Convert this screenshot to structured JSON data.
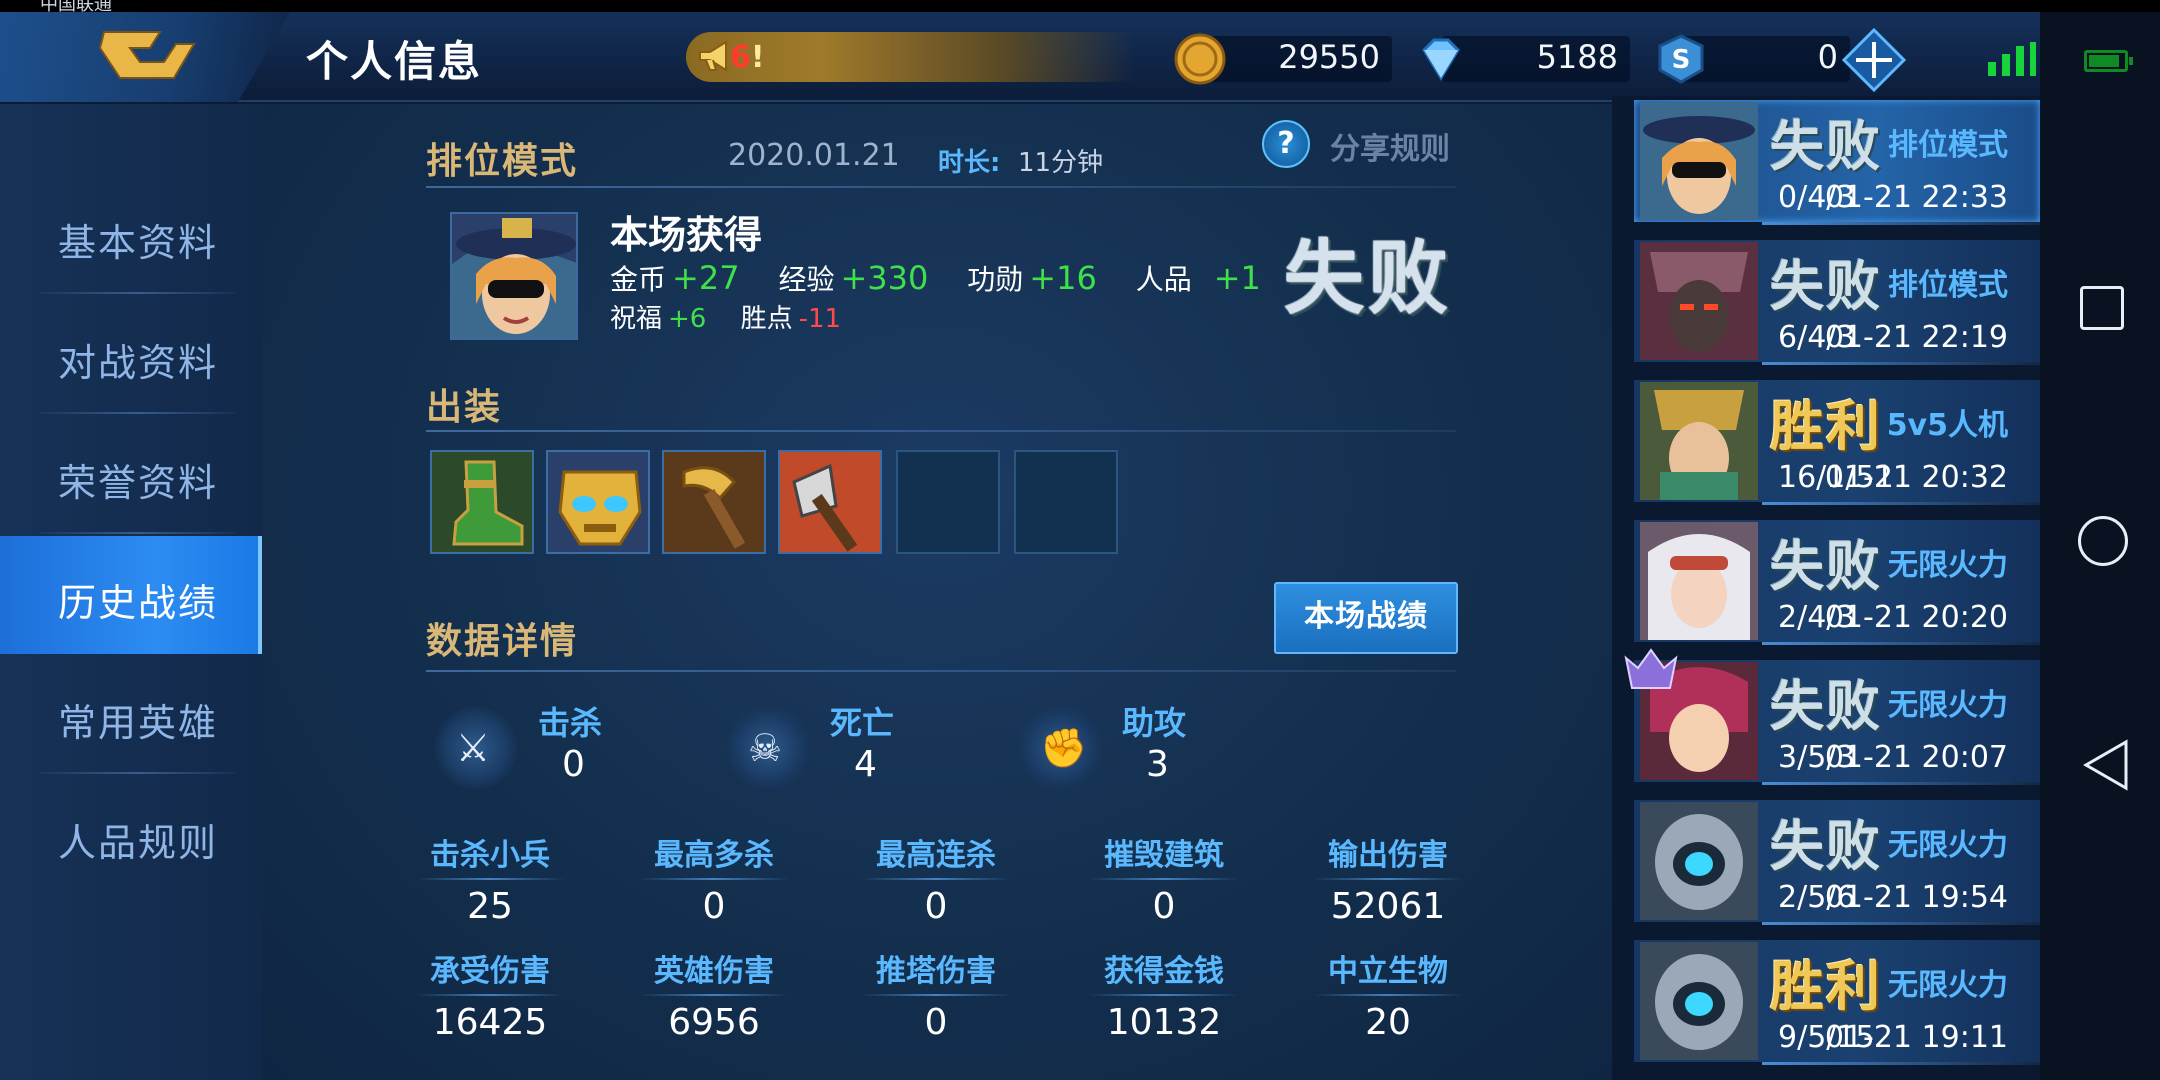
{
  "status_bar": {
    "carrier": "中国联通"
  },
  "header": {
    "title": "个人信息",
    "speaker_count": "6",
    "speaker_suffix": "!",
    "gold": "29550",
    "diamonds": "5188",
    "s_points": "0"
  },
  "sidebar": {
    "items": [
      {
        "label": "基本资料",
        "active": false
      },
      {
        "label": "对战资料",
        "active": false
      },
      {
        "label": "荣誉资料",
        "active": false
      },
      {
        "label": "历史战绩",
        "active": true
      },
      {
        "label": "常用英雄",
        "active": false
      },
      {
        "label": "人品规则",
        "active": false
      }
    ]
  },
  "match": {
    "mode": "排位模式",
    "date": "2020.01.21",
    "duration_label": "时长:",
    "duration": "11分钟",
    "share_icon": "?",
    "share_label": "分享规则",
    "rewards_title": "本场获得",
    "rewards": {
      "gold_label": "金币",
      "gold": "+27",
      "exp_label": "经验",
      "exp": "+330",
      "merit_label": "功勋",
      "merit": "+16",
      "char_label": "人品",
      "char": "+1",
      "bless_label": "祝福",
      "bless": "+6",
      "points_label": "胜点",
      "points": "-11"
    },
    "result": "失败",
    "equipment_title": "出装",
    "equipment": [
      "green-boots-icon",
      "golden-mask-icon",
      "golden-axe-icon",
      "war-axe-icon",
      "empty",
      "empty"
    ],
    "details_title": "数据详情",
    "match_stats_button": "本场战绩",
    "kda": [
      {
        "label": "击杀",
        "value": "0",
        "icon": "sword-icon"
      },
      {
        "label": "死亡",
        "value": "4",
        "icon": "skull-icon"
      },
      {
        "label": "助攻",
        "value": "3",
        "icon": "fist-icon"
      }
    ],
    "stats_row1": [
      {
        "label": "击杀小兵",
        "value": "25"
      },
      {
        "label": "最高多杀",
        "value": "0"
      },
      {
        "label": "最高连杀",
        "value": "0"
      },
      {
        "label": "摧毁建筑",
        "value": "0"
      },
      {
        "label": "输出伤害",
        "value": "52061"
      }
    ],
    "stats_row2": [
      {
        "label": "承受伤害",
        "value": "16425"
      },
      {
        "label": "英雄伤害",
        "value": "6956"
      },
      {
        "label": "推塔伤害",
        "value": "0"
      },
      {
        "label": "获得金钱",
        "value": "10132"
      },
      {
        "label": "中立生物",
        "value": "20"
      }
    ]
  },
  "history": [
    {
      "result": "失败",
      "win": false,
      "kda": "0/4/3",
      "mode": "排位模式",
      "time": "01-21 22:33",
      "selected": true,
      "avatar": "masked-hero"
    },
    {
      "result": "失败",
      "win": false,
      "kda": "6/4/3",
      "mode": "排位模式",
      "time": "01-21 22:19",
      "selected": false,
      "avatar": "samurai-hero"
    },
    {
      "result": "胜利",
      "win": true,
      "kda": "16/1/51",
      "mode": "5v5人机",
      "time": "01-21 20:32",
      "selected": false,
      "avatar": "golden-helm-hero"
    },
    {
      "result": "失败",
      "win": false,
      "kda": "2/4/3",
      "mode": "无限火力",
      "time": "01-21 20:20",
      "selected": false,
      "avatar": "goggles-girl-hero"
    },
    {
      "result": "失败",
      "win": false,
      "kda": "3/5/3",
      "mode": "无限火力",
      "time": "01-21 20:07",
      "selected": false,
      "avatar": "red-hair-hero"
    },
    {
      "result": "失败",
      "win": false,
      "kda": "2/5/6",
      "mode": "无限火力",
      "time": "01-21 19:54",
      "selected": false,
      "avatar": "mech-hero"
    },
    {
      "result": "胜利",
      "win": true,
      "kda": "9/5/15",
      "mode": "无限火力",
      "time": "01-21 19:11",
      "selected": false,
      "avatar": "mech-hero"
    }
  ],
  "colors": {
    "accent_blue": "#5ab8ff",
    "gold_title": "#d9b777",
    "positive": "#3fe04a",
    "negative": "#ff4a4a"
  }
}
